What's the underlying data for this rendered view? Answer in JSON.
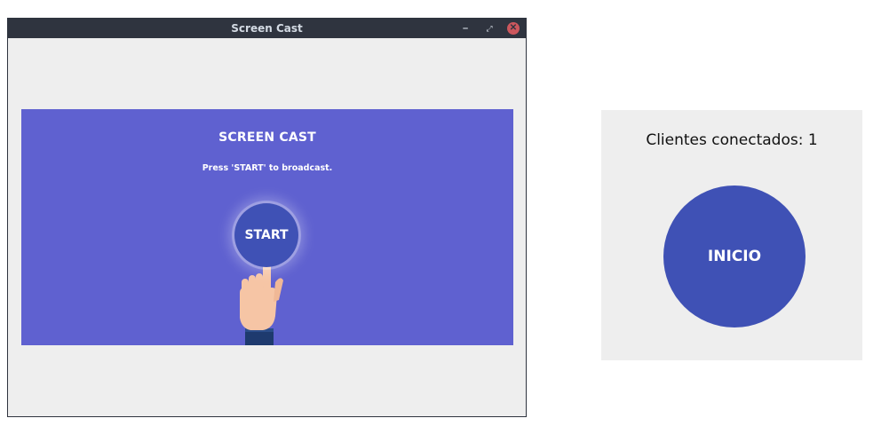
{
  "window": {
    "title": "Screen Cast",
    "controls": {
      "minimize": "–",
      "maximize": "⤢",
      "close": "✕"
    }
  },
  "banner": {
    "title": "SCREEN CAST",
    "subtitle": "Press 'START' to broadcast.",
    "start_label": "START",
    "illustration_icon": "pointing-hand-icon",
    "background_color": "#5f61d0"
  },
  "mobile_app": {
    "clients_label": "Clientes conectados: 1",
    "start_label": "INICIO",
    "button_color": "#3f51b5"
  }
}
